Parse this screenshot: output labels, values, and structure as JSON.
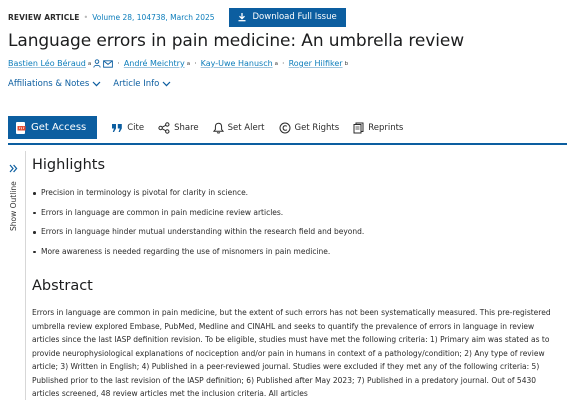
{
  "header": {
    "article_type": "REVIEW ARTICLE",
    "volume_info": "Volume 28, 104738, March 2025",
    "download_label": "Download Full Issue"
  },
  "title": "Language errors in pain medicine: An umbrella review",
  "authors": [
    {
      "name": "Bastien Léo Béraud",
      "sup": "a"
    },
    {
      "name": "André Meichtry",
      "sup": "a"
    },
    {
      "name": "Kay-Uwe Hanusch",
      "sup": "a"
    },
    {
      "name": "Roger Hilfiker",
      "sup": "b"
    }
  ],
  "info_links": {
    "affiliations": "Affiliations & Notes",
    "article_info": "Article Info"
  },
  "toolbar": {
    "get_access": "Get Access",
    "cite": "Cite",
    "share": "Share",
    "set_alert": "Set Alert",
    "get_rights": "Get Rights",
    "reprints": "Reprints"
  },
  "sidebar": {
    "show_outline": "Show Outline"
  },
  "highlights": {
    "title": "Highlights",
    "items": [
      "Precision in terminology is pivotal for clarity in science.",
      "Errors in language are common in pain medicine review articles.",
      "Errors in language hinder mutual understanding within the research field and beyond.",
      "More awareness is needed regarding the use of misnomers in pain medicine."
    ]
  },
  "abstract": {
    "title": "Abstract",
    "text": "Errors in language are common in pain medicine, but the extent of such errors has not been systematically measured. This pre-registered umbrella review explored Embase, PubMed, Medline and CINAHL and seeks to quantify the prevalence of errors in language in review articles since the last IASP definition revision. To be eligible, studies must have met the following criteria: 1) Primary aim was stated as to provide neurophysiological explanations of nociception and/or pain in humans in context of a pathology/condition; 2) Any type of review article; 3) Written in English; 4) Published in a peer-reviewed journal. Studies were excluded if they met any of the following criteria: 5) Published prior to the last revision of the IASP definition; 6) Published after May 2023; 7) Published in a predatory journal. Out of 5430 articles screened, 48 review articles met the inclusion criteria. All articles"
  },
  "colors": {
    "brand_blue": "#0c5ea0",
    "link_blue": "#0c7dbb",
    "pdf_red": "#e2492f"
  }
}
